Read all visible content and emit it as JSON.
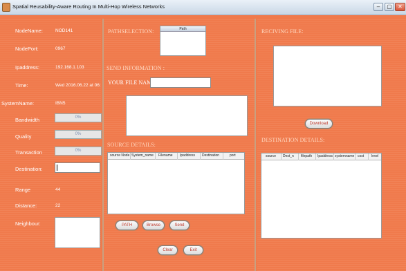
{
  "window": {
    "title": "Spatial Reusability-Aware Routing In Multi-Hop Wireless Networks",
    "minimize": "–",
    "maximize": "▢",
    "close": "✕"
  },
  "left": {
    "node_name_label": "NodeName:",
    "node_name_value": "NOD141",
    "node_port_label": "NodePort:",
    "node_port_value": "0967",
    "ip_label": "Ipaddress:",
    "ip_value": "192.168.1.103",
    "time_label": "Time:",
    "time_value": "Wed 2016.06.22 at 06:1...",
    "system_name_label": "SystemName:",
    "system_name_value": "IBN5",
    "bandwidth_label": "Bandwidth",
    "bandwidth_progress": "0%",
    "quality_label": "Quality",
    "quality_progress": "0%",
    "transaction_label": "Transaction",
    "transaction_progress": "0%",
    "destination_label": "Destination:",
    "destination_value": "",
    "range_label": "Range",
    "range_value": "44",
    "distance_label": "Distance:",
    "distance_value": "22",
    "neighbour_label": "Neighbour:"
  },
  "middle": {
    "path_selection_title": "PATHSELECTION:",
    "path_list_header": "Path",
    "send_info_title": "SEND INFORMATION :",
    "file_name_label": "YOUR FILE NAME :",
    "file_name_value": "",
    "source_details_title": "SOURCE DETAILS:",
    "source_columns": [
      "source Node",
      "System_name",
      "Filename",
      "Ipaddress",
      "Destination",
      "port"
    ],
    "buttons": {
      "path": "PATH",
      "browse": "Browse",
      "send": "Send",
      "clear": "Clear",
      "exit": "Exit"
    }
  },
  "right": {
    "receiving_file_title": "RECIVING FILE:",
    "download_button": "Download",
    "destination_details_title": "DESTINATION DETAILS:",
    "destination_columns": [
      "source",
      "Dest_n",
      "filepath",
      "Ipaddress",
      "systemname",
      "cost",
      "level"
    ]
  }
}
